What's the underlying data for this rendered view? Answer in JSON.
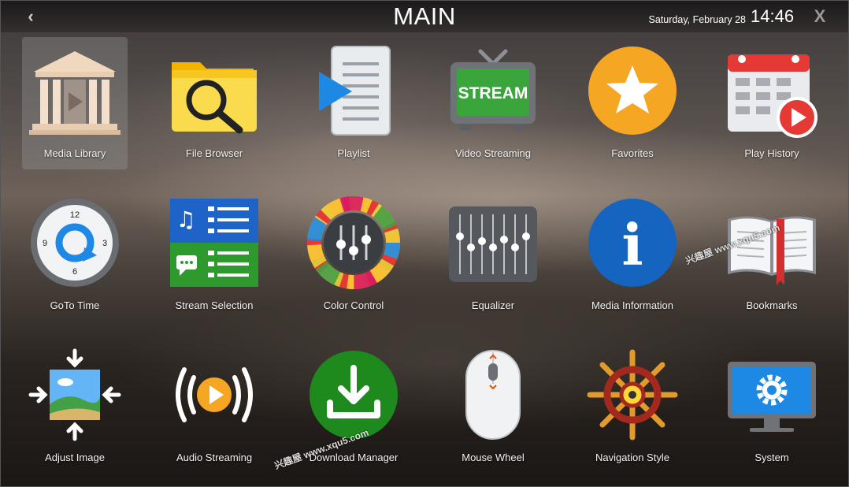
{
  "header": {
    "back_glyph": "‹",
    "title": "MAIN",
    "date": "Saturday, February 28",
    "time": "14:46",
    "close_glyph": "X"
  },
  "tiles": [
    {
      "label": "Media Library",
      "icon": "media-library-icon",
      "selected": true
    },
    {
      "label": "File Browser",
      "icon": "folder-search-icon"
    },
    {
      "label": "Playlist",
      "icon": "playlist-icon"
    },
    {
      "label": "Video Streaming",
      "icon": "tv-stream-icon",
      "icon_text": "STREAM"
    },
    {
      "label": "Favorites",
      "icon": "star-icon"
    },
    {
      "label": "Play History",
      "icon": "calendar-play-icon"
    },
    {
      "label": "GoTo Time",
      "icon": "clock-icon",
      "icon_text": [
        "12",
        "3",
        "6",
        "9"
      ]
    },
    {
      "label": "Stream Selection",
      "icon": "stream-selection-icon"
    },
    {
      "label": "Color Control",
      "icon": "color-gear-icon"
    },
    {
      "label": "Equalizer",
      "icon": "equalizer-icon"
    },
    {
      "label": "Media Information",
      "icon": "info-icon",
      "icon_text": "i"
    },
    {
      "label": "Bookmarks",
      "icon": "book-bookmark-icon"
    },
    {
      "label": "Adjust Image",
      "icon": "adjust-image-icon"
    },
    {
      "label": "Audio Streaming",
      "icon": "audio-stream-icon"
    },
    {
      "label": "Download Manager",
      "icon": "download-icon"
    },
    {
      "label": "Mouse Wheel",
      "icon": "mouse-icon"
    },
    {
      "label": "Navigation Style",
      "icon": "ship-wheel-icon"
    },
    {
      "label": "System",
      "icon": "monitor-gear-icon"
    }
  ],
  "watermarks": [
    "兴趣屋 www.xqu5.com",
    "兴趣屋 www.xqu5.com"
  ],
  "colors": {
    "accent_orange": "#f5a623",
    "info_blue": "#1565c0",
    "download_green": "#1e8a1e",
    "record_red": "#e53935",
    "tv_green": "#3aa53a"
  }
}
